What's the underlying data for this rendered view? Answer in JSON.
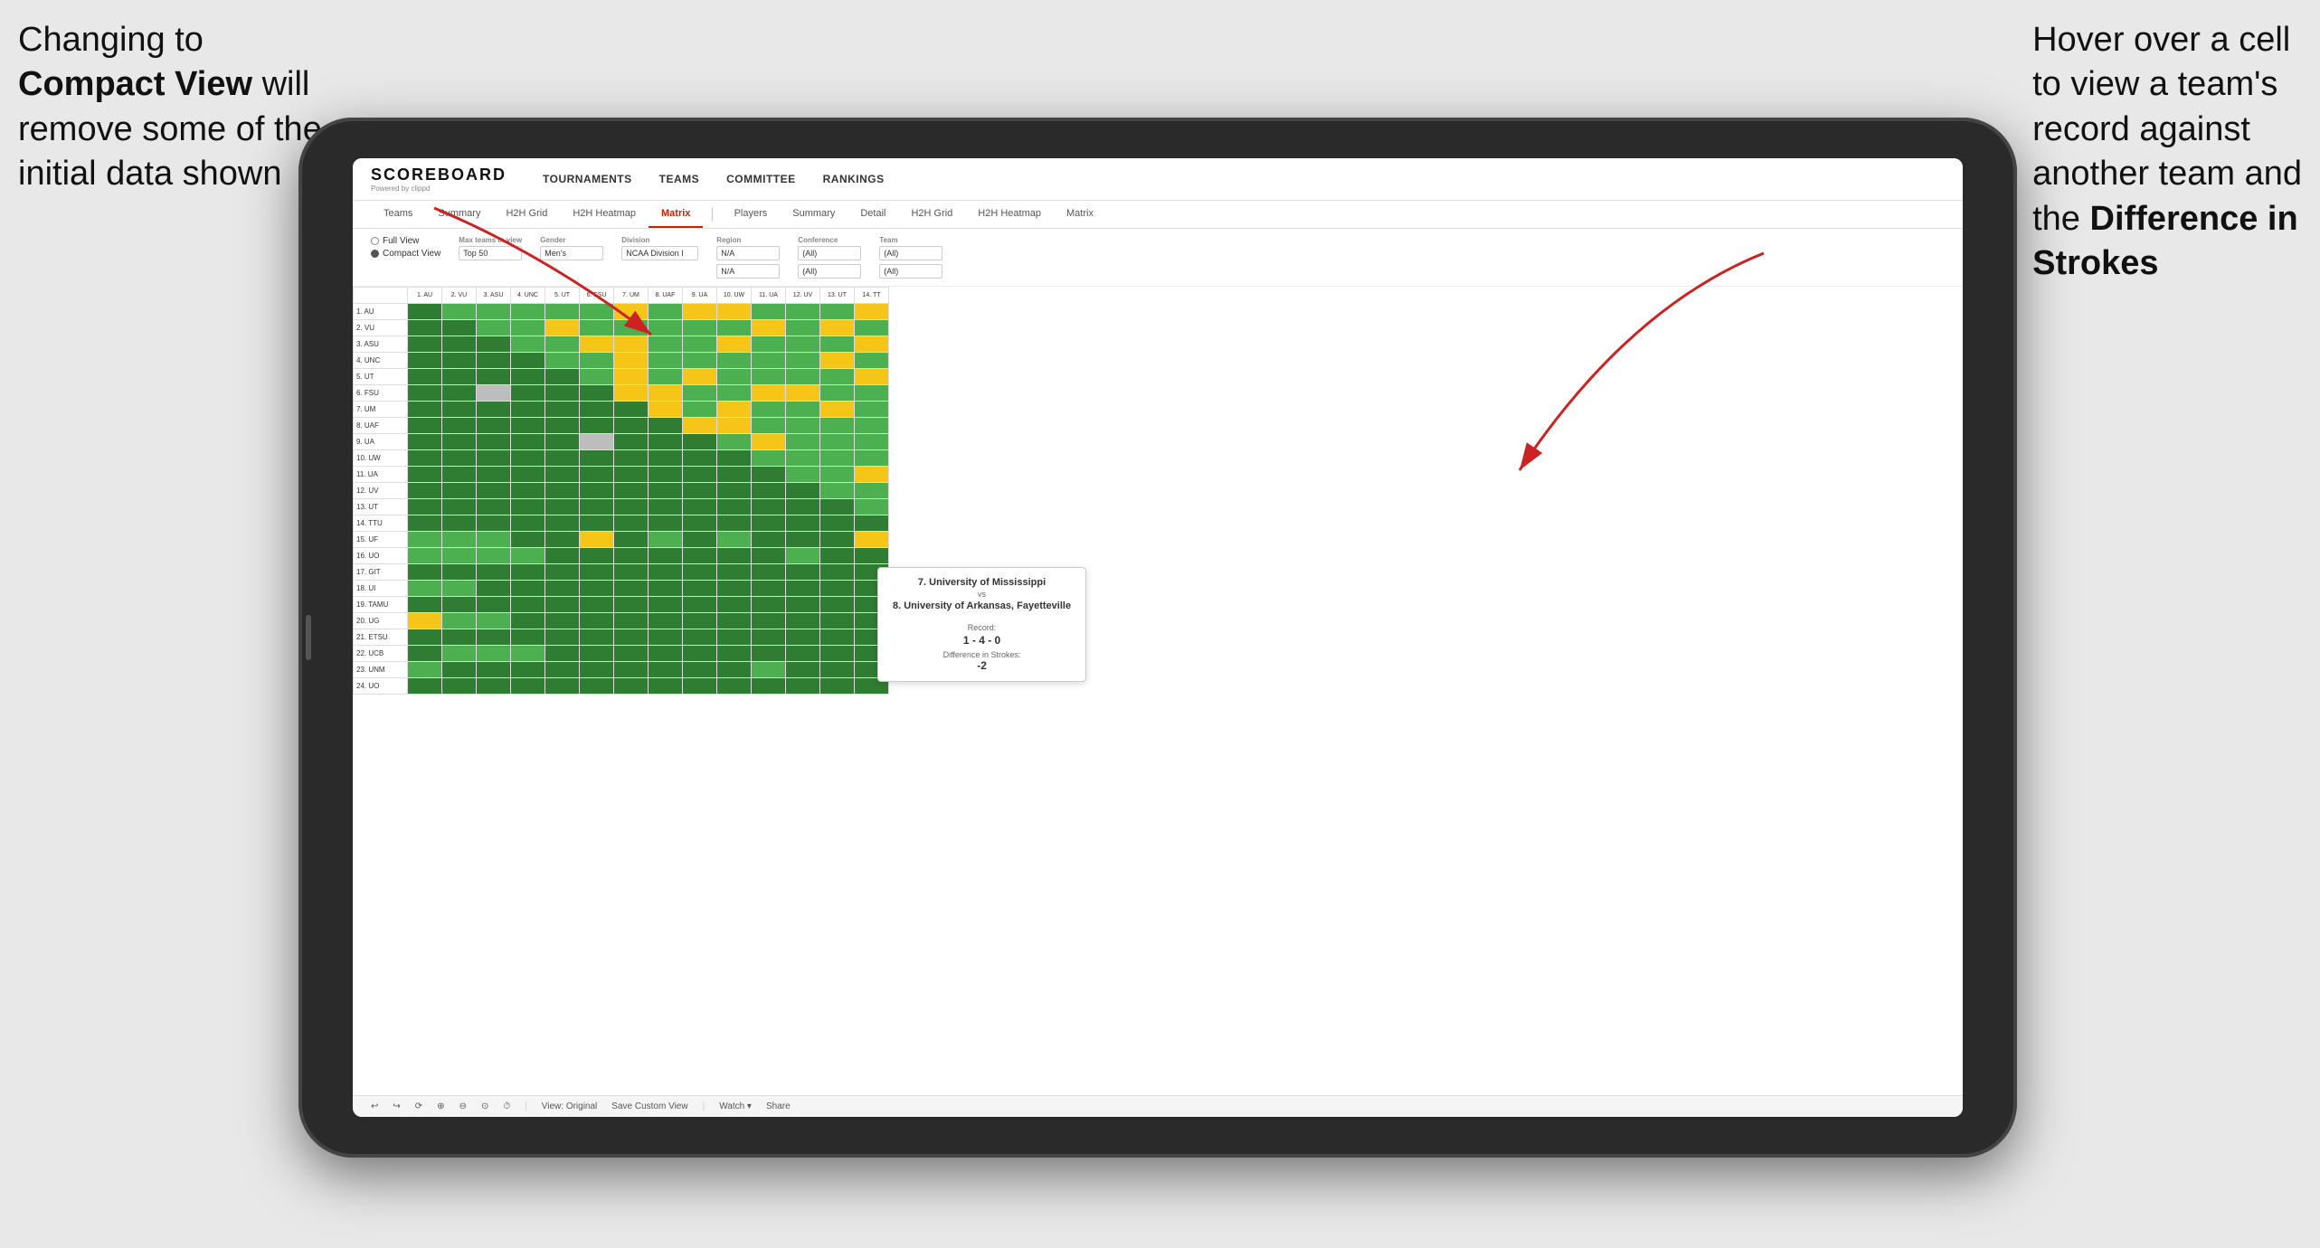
{
  "annotation_left": {
    "line1": "Changing to",
    "line2_bold": "Compact View",
    "line2_rest": " will",
    "line3": "remove some of the",
    "line4": "initial data shown"
  },
  "annotation_right": {
    "line1": "Hover over a cell",
    "line2": "to view a team's",
    "line3": "record against",
    "line4": "another team and",
    "line5_pre": "the ",
    "line5_bold": "Difference in",
    "line6_bold": "Strokes"
  },
  "nav": {
    "logo": "SCOREBOARD",
    "logo_sub": "Powered by clippd",
    "items": [
      "TOURNAMENTS",
      "TEAMS",
      "COMMITTEE",
      "RANKINGS"
    ]
  },
  "sub_tabs": {
    "group1": [
      "Teams",
      "Summary",
      "H2H Grid",
      "H2H Heatmap",
      "Matrix"
    ],
    "group2": [
      "Players",
      "Summary",
      "Detail",
      "H2H Grid",
      "H2H Heatmap",
      "Matrix"
    ],
    "active": "Matrix"
  },
  "controls": {
    "view_full": "Full View",
    "view_compact": "Compact View",
    "filters": [
      {
        "label": "Max teams in view",
        "value": "Top 50"
      },
      {
        "label": "Gender",
        "value": "Men's"
      },
      {
        "label": "Division",
        "value": "NCAA Division I"
      },
      {
        "label": "Region",
        "value": "N/A"
      },
      {
        "label": "Conference",
        "value": "(All)"
      },
      {
        "label": "Team",
        "value": "(All)"
      }
    ]
  },
  "matrix": {
    "col_headers": [
      "1. AU",
      "2. VU",
      "3. ASU",
      "4. UNC",
      "5. UT",
      "6. FSU",
      "7. UM",
      "8. UAF",
      "9. UA",
      "10. UW",
      "11. UA",
      "12. UV",
      "13. UT",
      "14. TT"
    ],
    "row_headers": [
      "1. AU",
      "2. VU",
      "3. ASU",
      "4. UNC",
      "5. UT",
      "6. FSU",
      "7. UM",
      "8. UAF",
      "9. UA",
      "10. UW",
      "11. UA",
      "12. UV",
      "13. UT",
      "14. TTU",
      "15. UF",
      "16. UO",
      "17. GIT",
      "18. UI",
      "19. TAMU",
      "20. UG",
      "21. ETSU",
      "22. UCB",
      "23. UNM",
      "24. UO"
    ]
  },
  "tooltip": {
    "team1": "7. University of Mississippi",
    "vs": "vs",
    "team2": "8. University of Arkansas, Fayetteville",
    "record_label": "Record:",
    "record": "1 - 4 - 0",
    "diff_label": "Difference in Strokes:",
    "diff": "-2"
  },
  "bottom_toolbar": {
    "buttons": [
      "↩",
      "↪",
      "⟳",
      "⊕",
      "⊖",
      "⊙",
      "⏱"
    ],
    "view_original": "View: Original",
    "save_custom": "Save Custom View",
    "watch": "Watch ▾",
    "share": "Share"
  }
}
